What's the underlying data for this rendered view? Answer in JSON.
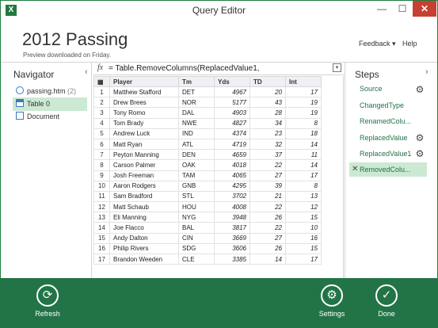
{
  "window": {
    "title": "Query Editor",
    "app_icon": "X",
    "minimize": "—",
    "maximize": "☐",
    "close": "✕"
  },
  "header": {
    "title": "2012 Passing",
    "subtitle": "Preview downloaded on Friday.",
    "feedback": "Feedback ▾",
    "help": "Help"
  },
  "navigator": {
    "title": "Navigator",
    "collapse": "‹",
    "items": [
      {
        "label": "passing.htm",
        "count": "(2)"
      },
      {
        "label": "Table 0"
      },
      {
        "label": "Document"
      }
    ]
  },
  "formula_bar": {
    "fx": "fx",
    "formula": "= Table.RemoveColumns(ReplacedValue1,"
  },
  "grid": {
    "corner": "▦",
    "columns": [
      "Player",
      "Tm",
      "Yds",
      "TD",
      "Int"
    ],
    "rows": [
      [
        "1",
        "Matthew Stafford",
        "DET",
        "4967",
        "20",
        "17"
      ],
      [
        "2",
        "Drew Brees",
        "NOR",
        "5177",
        "43",
        "19"
      ],
      [
        "3",
        "Tony Romo",
        "DAL",
        "4903",
        "28",
        "19"
      ],
      [
        "4",
        "Tom Brady",
        "NWE",
        "4827",
        "34",
        "8"
      ],
      [
        "5",
        "Andrew Luck",
        "IND",
        "4374",
        "23",
        "18"
      ],
      [
        "6",
        "Matt Ryan",
        "ATL",
        "4719",
        "32",
        "14"
      ],
      [
        "7",
        "Peyton Manning",
        "DEN",
        "4659",
        "37",
        "11"
      ],
      [
        "8",
        "Carson Palmer",
        "OAK",
        "4018",
        "22",
        "14"
      ],
      [
        "9",
        "Josh Freeman",
        "TAM",
        "4065",
        "27",
        "17"
      ],
      [
        "10",
        "Aaron Rodgers",
        "GNB",
        "4295",
        "39",
        "8"
      ],
      [
        "11",
        "Sam Bradford",
        "STL",
        "3702",
        "21",
        "13"
      ],
      [
        "12",
        "Matt Schaub",
        "HOU",
        "4008",
        "22",
        "12"
      ],
      [
        "13",
        "Eli Manning",
        "NYG",
        "3948",
        "26",
        "15"
      ],
      [
        "14",
        "Joe Flacco",
        "BAL",
        "3817",
        "22",
        "10"
      ],
      [
        "15",
        "Andy Dalton",
        "CIN",
        "3669",
        "27",
        "16"
      ],
      [
        "16",
        "Philip Rivers",
        "SDG",
        "3606",
        "26",
        "15"
      ],
      [
        "17",
        "Brandon Weeden",
        "CLE",
        "3385",
        "14",
        "17"
      ]
    ]
  },
  "steps": {
    "title": "Steps",
    "collapse": "›",
    "items": [
      {
        "label": "Source",
        "gear": true
      },
      {
        "label": "ChangedType",
        "gear": false
      },
      {
        "label": "RenamedColu...",
        "gear": false
      },
      {
        "label": "ReplacedValue",
        "gear": true
      },
      {
        "label": "ReplacedValue1",
        "gear": true
      },
      {
        "label": "RemovedColu...",
        "gear": false,
        "selected": true
      }
    ],
    "delete_mark": "✕"
  },
  "ribbon": {
    "refresh": {
      "label": "Refresh",
      "icon": "refresh-icon",
      "glyph": "⟳"
    },
    "settings": {
      "label": "Settings",
      "icon": "gear-icon",
      "glyph": "⚙"
    },
    "done": {
      "label": "Done",
      "icon": "check-icon",
      "glyph": "✓"
    }
  },
  "colors": {
    "ribbon": "#227446",
    "accent": "#217346",
    "selected": "#cbe9d3",
    "close": "#c84031"
  }
}
